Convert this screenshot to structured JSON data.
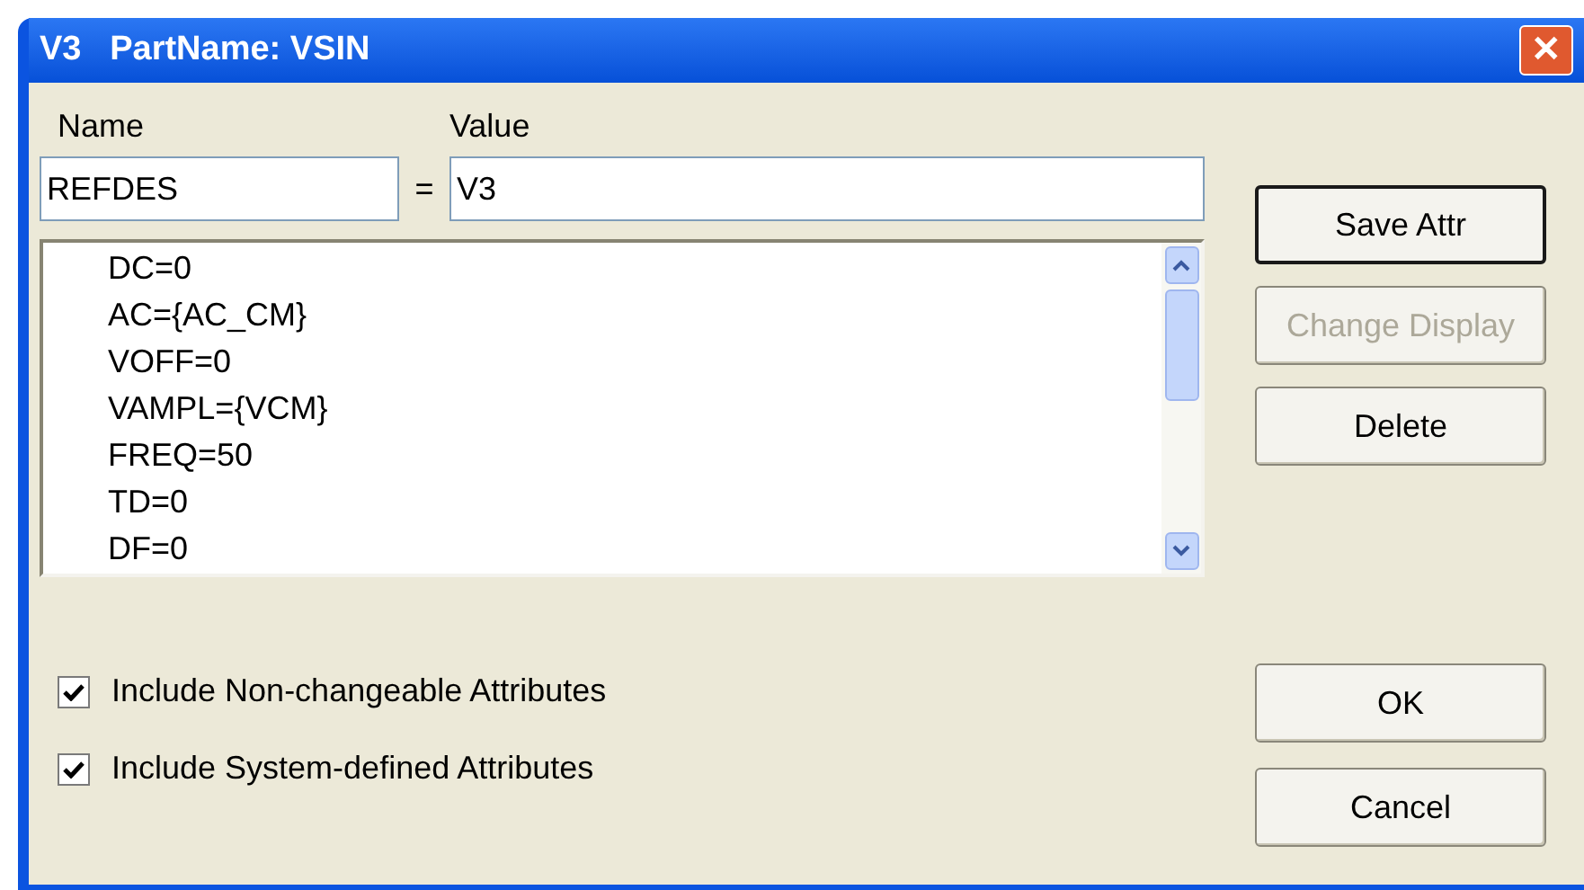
{
  "window": {
    "title": "V3   PartName: VSIN",
    "close_glyph": "✕"
  },
  "name_label": "Name",
  "value_label": "Value",
  "name_field": {
    "value": "REFDES"
  },
  "equals": "=",
  "value_field": {
    "value": "V3"
  },
  "attributes": [
    "DC=0",
    "AC={AC_CM}",
    "VOFF=0",
    "VAMPL={VCM}",
    "FREQ=50",
    "TD=0",
    "DF=0"
  ],
  "buttons": [
    {
      "label": "Save Attr",
      "disabled": false,
      "default": true
    },
    {
      "label": "Change Display",
      "disabled": true,
      "default": false
    },
    {
      "label": "Delete",
      "disabled": false,
      "default": false
    }
  ],
  "options": [
    {
      "label": "Include Non-changeable Attributes",
      "checked": true
    },
    {
      "label": "Include System-defined Attributes",
      "checked": true
    }
  ],
  "dialog_buttons": [
    {
      "label": "OK",
      "disabled": false,
      "default": false
    },
    {
      "label": "Cancel",
      "disabled": false,
      "default": false
    }
  ]
}
